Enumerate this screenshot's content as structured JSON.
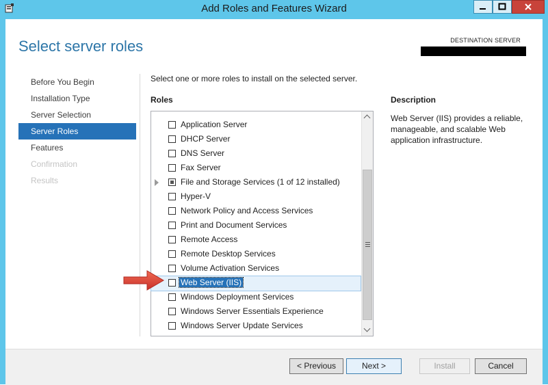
{
  "window": {
    "title": "Add Roles and Features Wizard",
    "controls": {
      "minimize": "minimize",
      "maximize": "maximize",
      "close": "close"
    }
  },
  "header": {
    "page_title": "Select server roles",
    "destination_label": "DESTINATION SERVER",
    "destination_value": ""
  },
  "nav": {
    "items": [
      {
        "label": "Before You Begin",
        "state": "normal"
      },
      {
        "label": "Installation Type",
        "state": "normal"
      },
      {
        "label": "Server Selection",
        "state": "normal"
      },
      {
        "label": "Server Roles",
        "state": "selected"
      },
      {
        "label": "Features",
        "state": "normal"
      },
      {
        "label": "Confirmation",
        "state": "disabled"
      },
      {
        "label": "Results",
        "state": "disabled"
      }
    ]
  },
  "main": {
    "instruction": "Select one or more roles to install on the selected server.",
    "roles_label": "Roles",
    "roles": [
      {
        "label": "Application Server",
        "checked": false
      },
      {
        "label": "DHCP Server",
        "checked": false
      },
      {
        "label": "DNS Server",
        "checked": false
      },
      {
        "label": "Fax Server",
        "checked": false
      },
      {
        "label": "File and Storage Services (1 of 12 installed)",
        "checked": "partial",
        "expandable": true
      },
      {
        "label": "Hyper-V",
        "checked": false
      },
      {
        "label": "Network Policy and Access Services",
        "checked": false
      },
      {
        "label": "Print and Document Services",
        "checked": false
      },
      {
        "label": "Remote Access",
        "checked": false
      },
      {
        "label": "Remote Desktop Services",
        "checked": false
      },
      {
        "label": "Volume Activation Services",
        "checked": false
      },
      {
        "label": "Web Server (IIS)",
        "checked": false,
        "highlighted": true
      },
      {
        "label": "Windows Deployment Services",
        "checked": false
      },
      {
        "label": "Windows Server Essentials Experience",
        "checked": false
      },
      {
        "label": "Windows Server Update Services",
        "checked": false
      }
    ],
    "description_label": "Description",
    "description_text": "Web Server (IIS) provides a reliable, manageable, and scalable Web application infrastructure."
  },
  "footer": {
    "previous_label": "< Previous",
    "next_label": "Next >",
    "install_label": "Install",
    "cancel_label": "Cancel"
  },
  "colors": {
    "title_bar": "#5ec6ea",
    "accent": "#2672b8",
    "page_title": "#2d76a8",
    "callout_arrow": "#e0402f"
  },
  "icons": {
    "app": "server-manager-icon",
    "callout": "red-arrow-icon"
  }
}
